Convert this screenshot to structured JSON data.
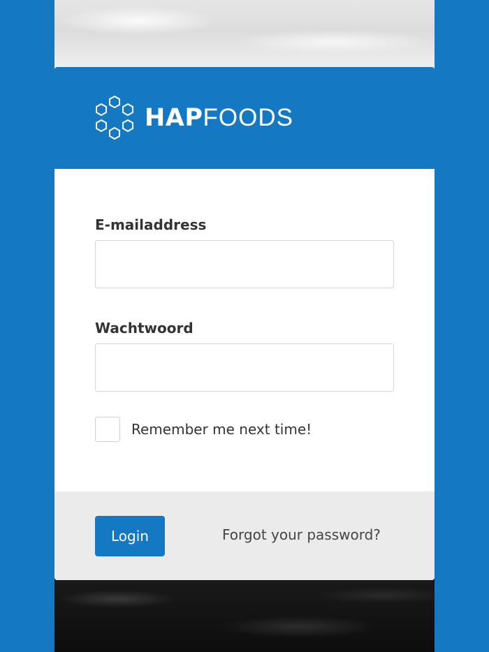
{
  "brand": {
    "name_bold": "HAP",
    "name_light": "FOODS",
    "logo_icon": "hexagon-cluster-icon"
  },
  "colors": {
    "primary": "#1578c2",
    "footer_bg": "#ebebeb",
    "text": "#333333"
  },
  "form": {
    "email": {
      "label": "E-mailaddress",
      "value": "",
      "placeholder": ""
    },
    "password": {
      "label": "Wachtwoord",
      "value": "",
      "placeholder": ""
    },
    "remember": {
      "label": "Remember me next time!",
      "checked": false
    }
  },
  "footer": {
    "login_label": "Login",
    "forgot_label": "Forgot your password?"
  }
}
